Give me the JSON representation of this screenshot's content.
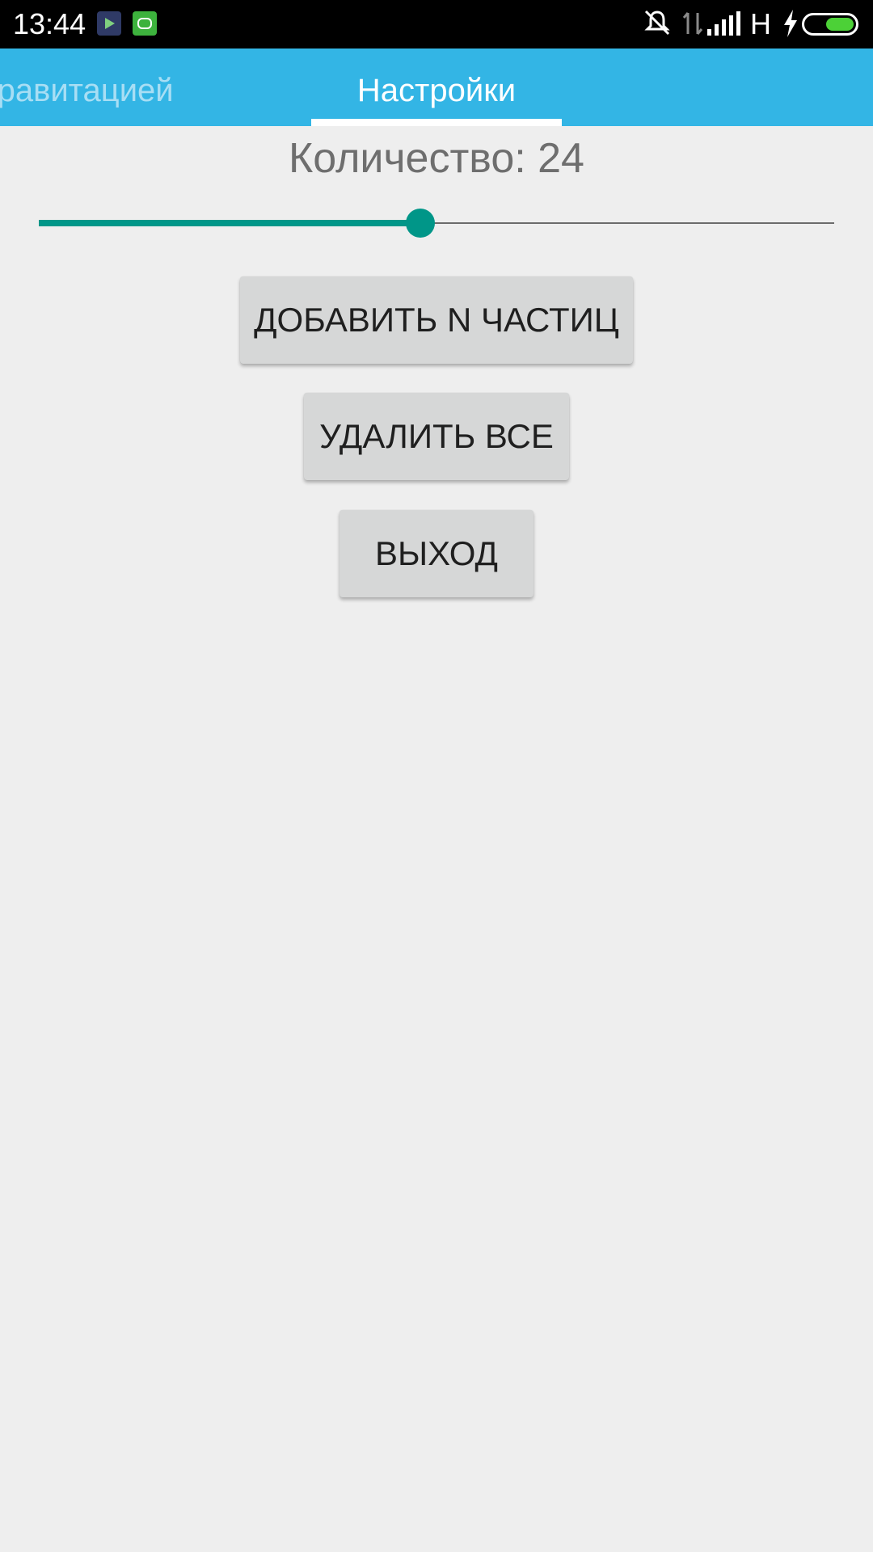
{
  "status_bar": {
    "time": "13:44",
    "network_type": "H",
    "icons": [
      "play-store-notification-icon",
      "robot-notification-icon",
      "mute-icon",
      "data-arrows-icon",
      "signal-icon",
      "charging-bolt-icon",
      "battery-icon"
    ]
  },
  "tabs": [
    {
      "label": "гравитацией",
      "selected": false
    },
    {
      "label": "Настройки",
      "selected": true
    }
  ],
  "settings": {
    "count_label": "Количество: 24",
    "slider_fraction": 0.48,
    "buttons": {
      "add": "ДОБАВИТЬ N ЧАСТИЦ",
      "clear": "УДАЛИТЬ ВСЕ",
      "exit": "ВЫХОД"
    }
  },
  "colors": {
    "tab_bar": "#33b5e5",
    "accent": "#009688",
    "background": "#eeeeee",
    "button": "#d6d7d7"
  }
}
